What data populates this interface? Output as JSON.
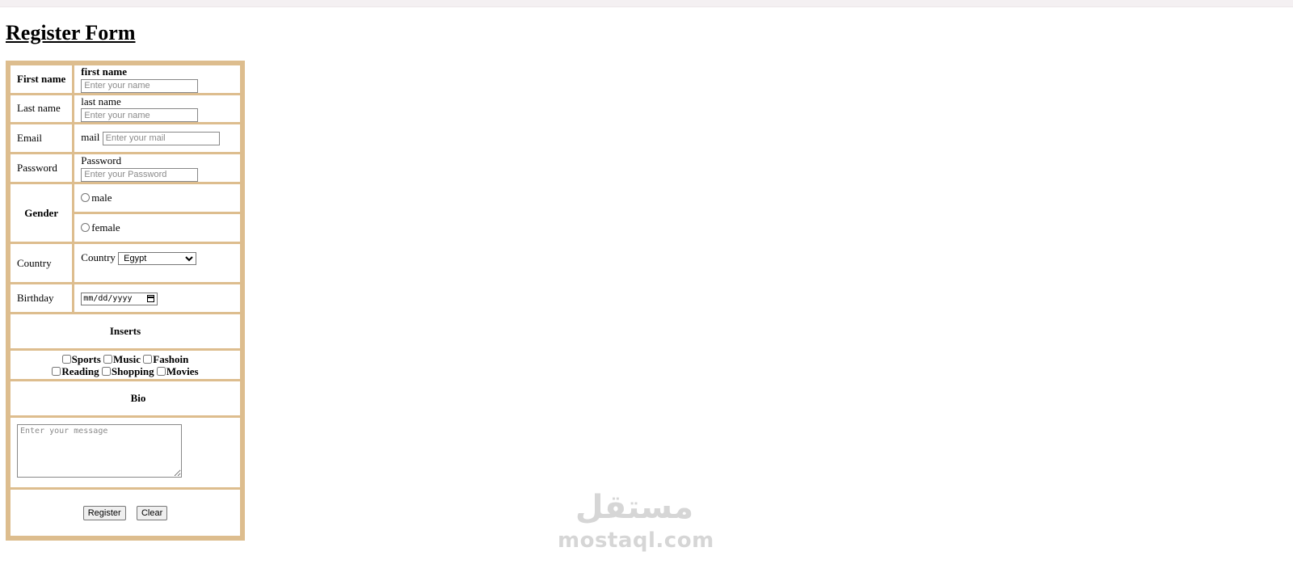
{
  "page": {
    "title": "Register Form"
  },
  "form": {
    "first_name": {
      "label": "First name",
      "field_label": "first name",
      "placeholder": "Enter your name"
    },
    "last_name": {
      "label": "Last name",
      "field_label": "last name",
      "placeholder": "Enter your name"
    },
    "email": {
      "label": "Email",
      "field_label": "mail",
      "placeholder": "Enter your mail"
    },
    "password": {
      "label": "Password",
      "field_label": "Password",
      "placeholder": "Enter your Password"
    },
    "gender": {
      "label": "Gender",
      "options": [
        "male",
        "female"
      ]
    },
    "country": {
      "label": "Country",
      "field_label": "Country",
      "selected": "Egypt"
    },
    "birthday": {
      "label": "Birthday",
      "placeholder": "mm/dd/yyyy"
    },
    "interests": {
      "header": "Inserts",
      "options": [
        "Sports",
        "Music",
        "Fashoin",
        "Reading",
        "Shopping",
        "Movies"
      ]
    },
    "bio": {
      "header": "Bio",
      "placeholder": "Enter your message"
    },
    "buttons": {
      "register": "Register",
      "clear": "Clear"
    }
  },
  "watermark": {
    "arabic": "مستقل",
    "latin": "mostaql.com"
  },
  "colors": {
    "table_border": "#ddbd8e",
    "watermark": "#d6d6d6"
  }
}
